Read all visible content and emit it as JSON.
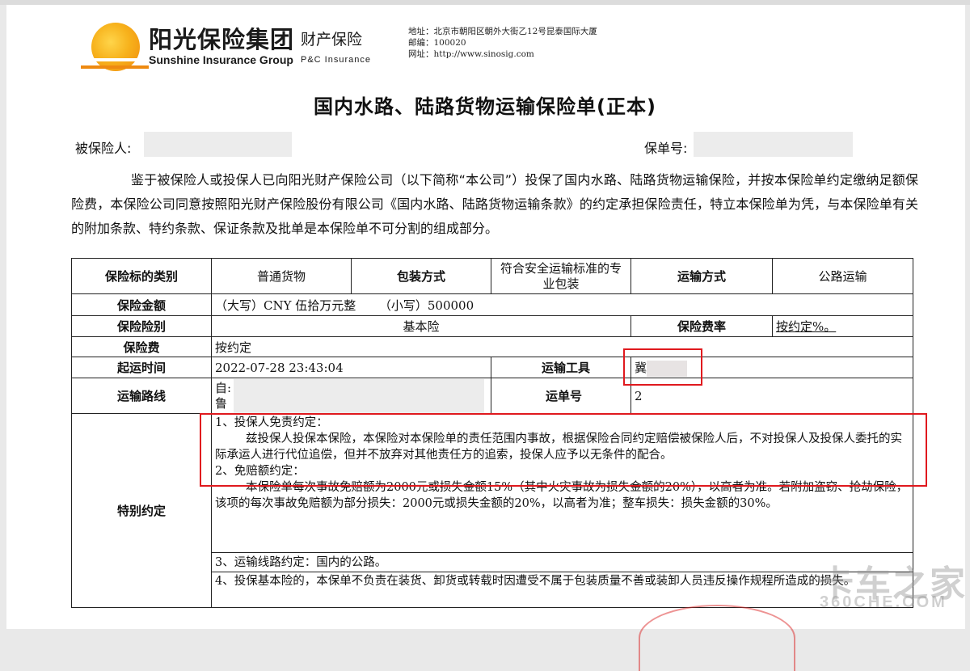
{
  "company": {
    "name_cn": "阳光保险集团",
    "name_en": "Sunshine Insurance Group",
    "division_cn": "财产保险",
    "division_en": "P&C Insurance",
    "address_line": "地址：北京市朝阳区朝外大街乙12号昆泰国际大厦",
    "postcode_line": "邮编：100020",
    "website_line": "网址：http://www.sinosig.com"
  },
  "document": {
    "title": "国内水路、陆路货物运输保险单(正本)",
    "insured_label": "被保险人:",
    "policy_no_label": "保单号:",
    "intro": "鉴于被保险人或投保人已向阳光财产保险公司（以下简称“本公司”）投保了国内水路、陆路货物运输保险，并按本保险单约定缴纳足额保险费，本保险公司同意按照阳光财产保险股份有限公司《国内水路、陆路货物运输条款》的约定承担保险责任，特立本保险单为凭，与本保险单有关的附加条款、特约条款、保证条款及批单是本保险单不可分割的组成部分。"
  },
  "table": {
    "cargo_type_label": "保险标的类别",
    "cargo_type_value": "普通货物",
    "packing_label": "包装方式",
    "packing_value": "符合安全运输标准的专业包装",
    "transport_mode_label": "运输方式",
    "transport_mode_value": "公路运输",
    "sum_insured_label": "保险金额",
    "sum_insured_value": "（大写）CNY 伍拾万元整      （小写）500000",
    "coverage_label": "保险险别",
    "coverage_value": "基本险",
    "rate_label": "保险费率",
    "rate_value": "按约定%。",
    "premium_label": "保险费",
    "premium_value": "按约定",
    "departure_label": "起运时间",
    "departure_value": "2022-07-28 23:43:04",
    "vehicle_label": "运输工具",
    "vehicle_value": "冀",
    "route_label": "运输路线",
    "route_from": "自:",
    "route_to": "鲁",
    "waybill_label": "运单号",
    "waybill_value": "2",
    "special_label": "特别约定",
    "clauses": {
      "c1_title": "1、投保人免责约定：",
      "c1_body": "兹投保人投保本保险，本保险对本保险单的责任范围内事故，根据保险合同约定赔偿被保险人后，不对投保人及投保人委托的实际承运人进行代位追偿，但并不放弃对其他责任方的追索，投保人应予以无条件的配合。",
      "c2_title": "2、免赔额约定：",
      "c2_body": "本保险单每次事故免赔额为2000元或损失金额15%（其中火灾事故为损失金额的20%），以高者为准。若附加盗窃、抢劫保险，该项的每次事故免赔额为部分损失：2000元或损失金额的20%，以高者为准；整车损失：损失金额的30%。",
      "c3": "3、运输线路约定：国内的公路。",
      "c4": "4、投保基本险的，本保单不负责在装货、卸货或转载时因遭受不属于包装质量不善或装卸人员违反操作规程所造成的损失。"
    }
  },
  "watermark": {
    "brand": "卡车之家",
    "site": "360CHE.COM"
  },
  "colors": {
    "highlight_box": "#e0191e",
    "logo_orange": "#f7b21c"
  }
}
